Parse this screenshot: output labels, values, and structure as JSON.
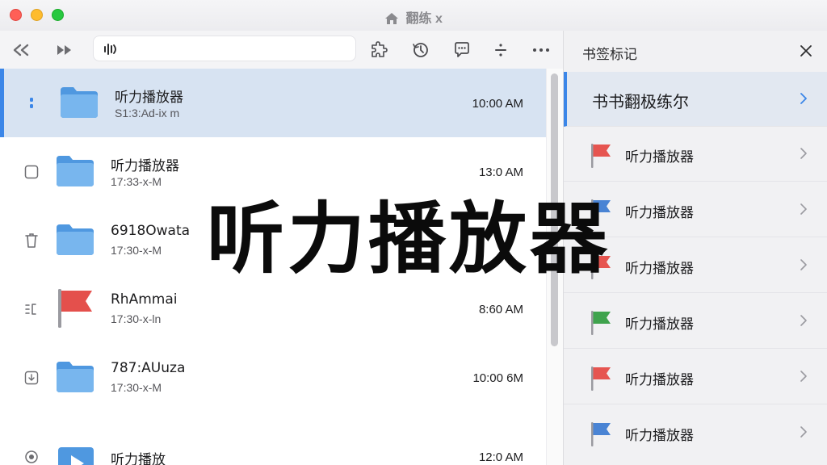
{
  "window": {
    "title": "翻练 x"
  },
  "address_bar": {
    "value": "",
    "placeholder": ""
  },
  "files": [
    {
      "name": "听力播放器",
      "sub": "S1:3:Ad-ix m",
      "time": "10:00 AM",
      "selected": true,
      "lead": "dot",
      "thumb": "folder"
    },
    {
      "name": "听力播放器",
      "sub": "17:33-x-M",
      "time": "13:0 AM",
      "selected": false,
      "lead": "checkbox",
      "thumb": "folder"
    },
    {
      "name": "6918Owata",
      "sub": "17:30-x-M",
      "time": "",
      "selected": false,
      "lead": "trash",
      "thumb": "folder"
    },
    {
      "name": "RhAmmai",
      "sub": "17:30-x-ln",
      "time": "8:60 AM",
      "selected": false,
      "lead": "list",
      "thumb": "flag"
    },
    {
      "name": "787:AUuza",
      "sub": "17:30-x-M",
      "time": "10:00 6M",
      "selected": false,
      "lead": "download",
      "thumb": "folder"
    },
    {
      "name": "听力播放",
      "sub": "",
      "time": "12:0 AM",
      "selected": false,
      "lead": "record",
      "thumb": "play"
    }
  ],
  "bookmarks": {
    "title": "书签标记",
    "items": [
      {
        "label": "书书翻极练尔",
        "flag": "none",
        "active": true
      },
      {
        "label": "听力播放器",
        "flag": "#e65550",
        "active": false
      },
      {
        "label": "听力播放器",
        "flag": "#4a84d4",
        "active": false
      },
      {
        "label": "听力播放器",
        "flag": "#e65550",
        "active": false
      },
      {
        "label": "听力播放器",
        "flag": "#3fa34d",
        "active": false
      },
      {
        "label": "听力播放器",
        "flag": "#e65550",
        "active": false
      },
      {
        "label": "听力播放器",
        "flag": "#4a84d4",
        "active": false
      }
    ]
  },
  "overlay": {
    "headline": "听力播放器"
  },
  "colors": {
    "accent": "#3b86e8",
    "selection": "#d7e3f2",
    "folder": "#6aaee9"
  }
}
